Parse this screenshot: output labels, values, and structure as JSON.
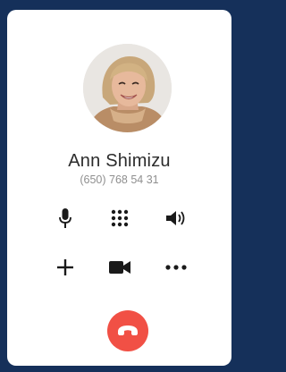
{
  "contact": {
    "name": "Ann Shimizu",
    "phone": "(650) 768 54 31",
    "avatar": "contact-photo"
  },
  "controls": [
    {
      "id": "mute",
      "icon": "microphone-icon"
    },
    {
      "id": "keypad",
      "icon": "keypad-icon"
    },
    {
      "id": "speaker",
      "icon": "speaker-icon"
    },
    {
      "id": "add-call",
      "icon": "plus-icon"
    },
    {
      "id": "video",
      "icon": "video-camera-icon"
    },
    {
      "id": "more",
      "icon": "more-icon"
    }
  ],
  "end_call": {
    "icon": "hang-up-icon"
  },
  "colors": {
    "background": "#15305a",
    "card": "#ffffff",
    "icon": "#1a1a1a",
    "end_call": "#f15045"
  }
}
